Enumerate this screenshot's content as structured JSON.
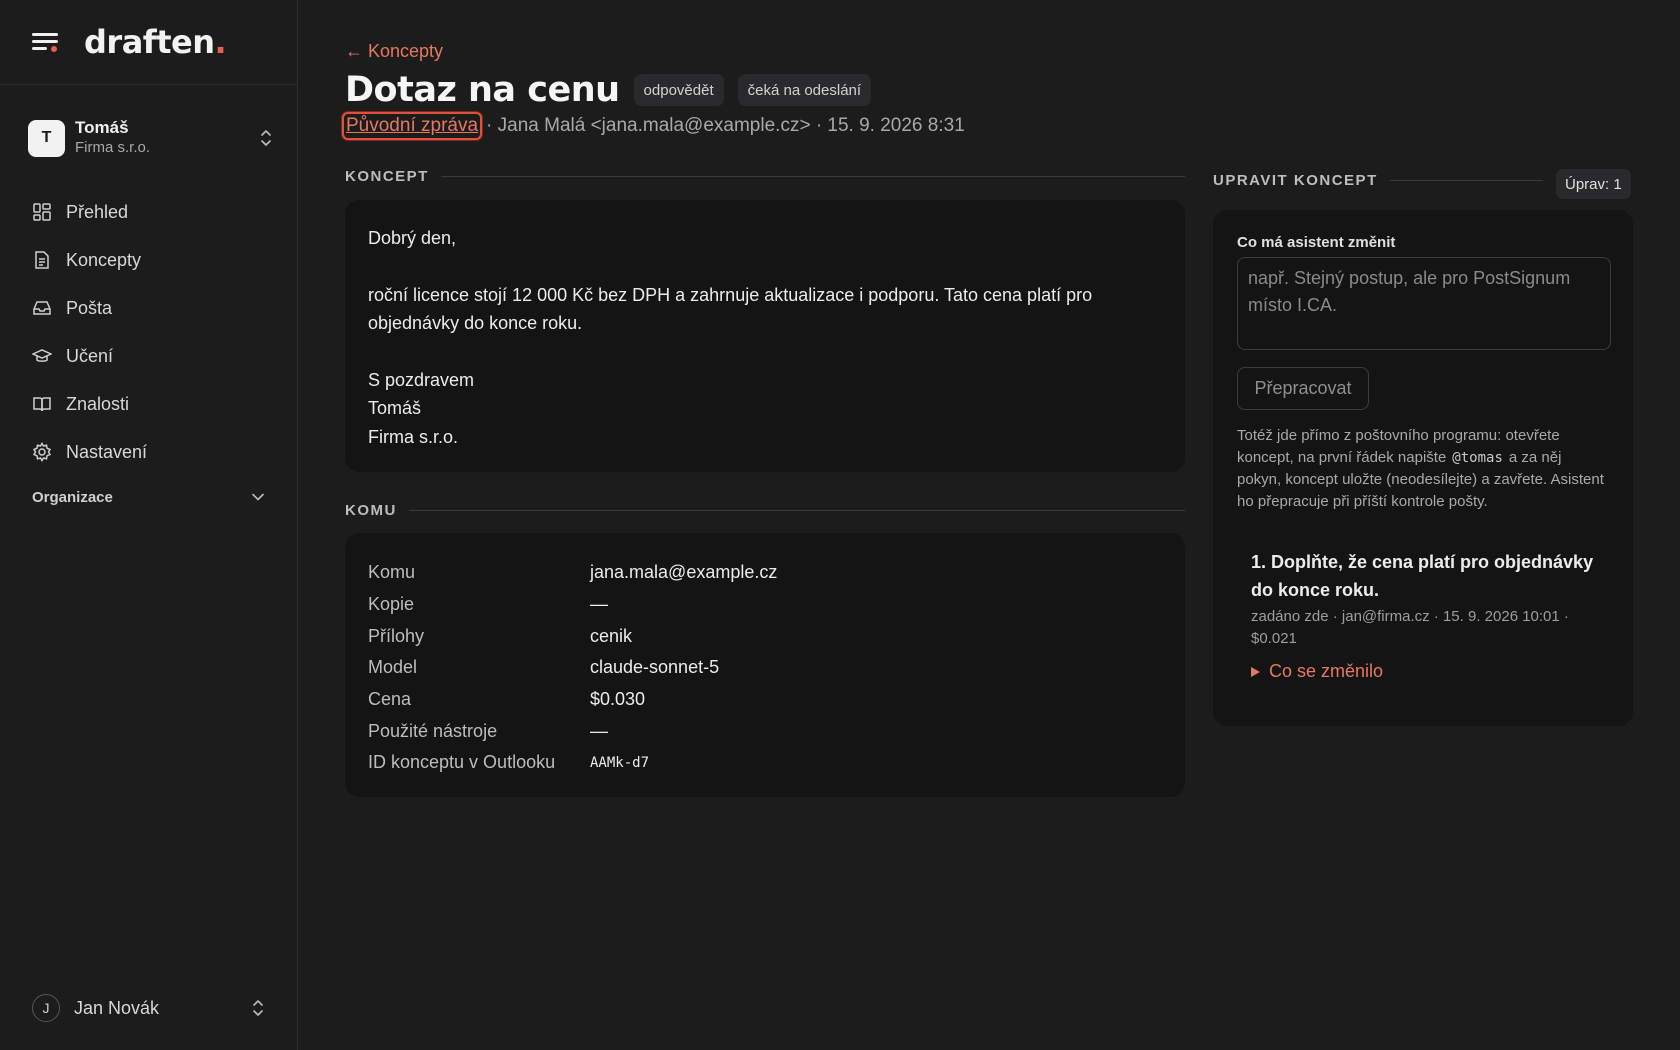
{
  "brand": {
    "logo_text": "draften",
    "logo_dot": ".",
    "accent": "#e8604a"
  },
  "account": {
    "initial": "T",
    "name": "Tomáš",
    "org": "Firma s.r.o."
  },
  "nav": {
    "items": [
      {
        "label": "Přehled",
        "icon": "dashboard-icon"
      },
      {
        "label": "Koncepty",
        "icon": "document-icon"
      },
      {
        "label": "Pošta",
        "icon": "inbox-icon"
      },
      {
        "label": "Učení",
        "icon": "graduation-cap-icon"
      },
      {
        "label": "Znalosti",
        "icon": "book-icon"
      },
      {
        "label": "Nastavení",
        "icon": "gear-icon"
      }
    ],
    "organization_label": "Organizace"
  },
  "user": {
    "initial": "J",
    "name": "Jan Novák"
  },
  "header": {
    "back_link": "← Koncepty",
    "title": "Dotaz na cenu",
    "badges": [
      "odpovědět",
      "čeká na odeslání"
    ],
    "original_link": "Původní zpráva",
    "meta": "· Jana Malá <jana.mala@example.cz> · 15. 9. 2026 8:31"
  },
  "draft": {
    "section_title": "KONCEPT",
    "greeting": "Dobrý den,",
    "body": "roční licence stojí 12 000 Kč bez DPH a zahrnuje aktualizace i podporu. Tato cena platí pro objednávky do konce roku.",
    "sign_1": "S pozdravem",
    "sign_2": "Tomáš",
    "sign_3": "Firma s.r.o."
  },
  "recipients": {
    "section_title": "KOMU",
    "rows": [
      {
        "key": "Komu",
        "value": "jana.mala@example.cz"
      },
      {
        "key": "Kopie",
        "value": "—"
      },
      {
        "key": "Přílohy",
        "value": "cenik"
      },
      {
        "key": "Model",
        "value": "claude-sonnet-5"
      },
      {
        "key": "Cena",
        "value": "$0.030"
      },
      {
        "key": "Použité nástroje",
        "value": "—"
      },
      {
        "key": "ID konceptu v Outlooku",
        "value": "AAMk-d7"
      }
    ]
  },
  "edit": {
    "section_title": "UPRAVIT KONCEPT",
    "edit_count": "Úprav: 1",
    "field_label": "Co má asistent změnit",
    "placeholder": "např. Stejný postup, ale pro PostSignum místo I.CA.",
    "button_label": "Přepracovat",
    "help_before": "Totéž jde přímo z poštovního programu: otevřete koncept, na první řádek napište",
    "help_code": "@tomas",
    "help_after": "a za něj pokyn, koncept uložte (neodesílejte) a zavřete. Asistent ho přepracuje při příští kontrole pošty.",
    "history": [
      {
        "title": "1. Doplňte, že cena platí pro objednávky do konce roku.",
        "meta": "zadáno zde · jan@firma.cz · 15. 9. 2026 10:01 · $0.021",
        "toggle": "Co se změnilo"
      }
    ]
  }
}
